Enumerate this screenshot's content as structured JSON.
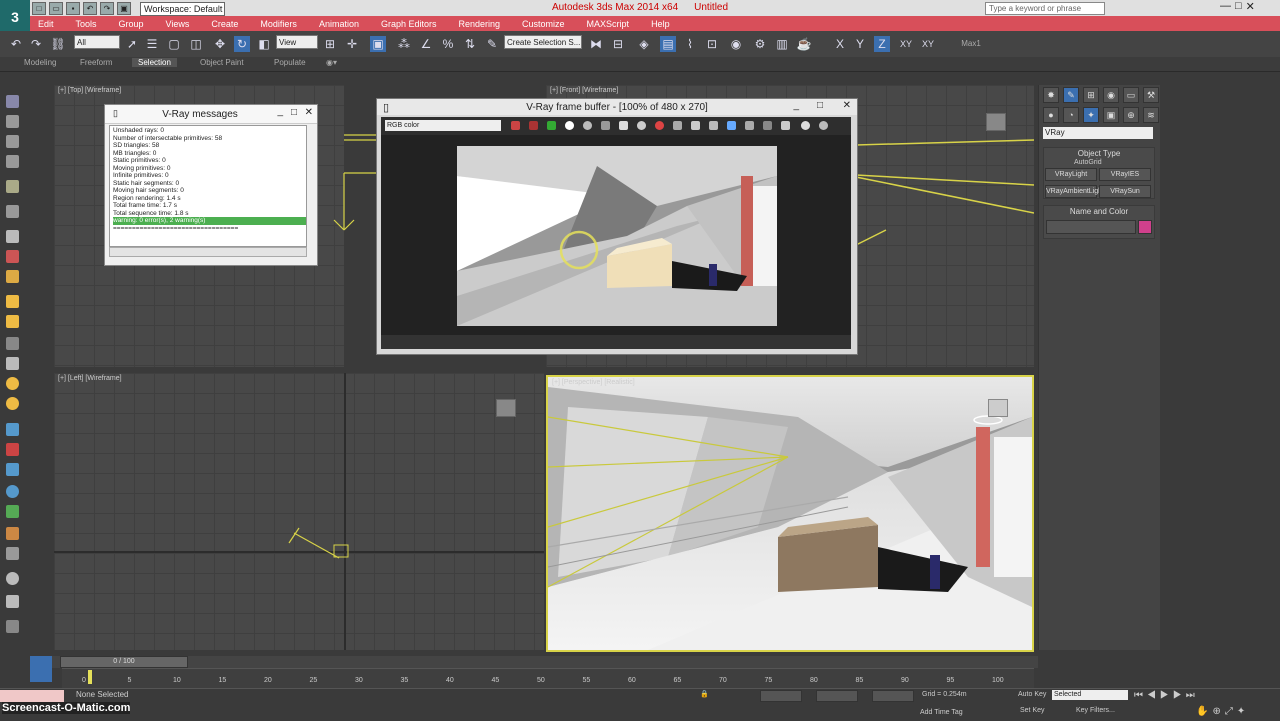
{
  "app": {
    "title": "Autodesk 3ds Max  2014 x64",
    "document": "Untitled",
    "workspace": "Workspace: Default",
    "help_placeholder": "Type a keyword or phrase"
  },
  "menus": [
    "Edit",
    "Tools",
    "Group",
    "Views",
    "Create",
    "Modifiers",
    "Animation",
    "Graph Editors",
    "Rendering",
    "Customize",
    "MAXScript",
    "Help"
  ],
  "toolbar": {
    "filter": "All",
    "view": "View",
    "selection_set": "Create Selection S...",
    "axes": [
      "X",
      "Y",
      "Z",
      "XY",
      "XY"
    ],
    "icons": [
      "undo-icon",
      "redo-icon",
      "link-icon",
      "unlink-icon",
      "bind-icon",
      "select-icon",
      "select-name-icon",
      "region-icon",
      "window-icon",
      "move-icon",
      "rotate-icon",
      "scale-icon",
      "pivot-icon",
      "snap-icon",
      "angle-snap-icon",
      "percent-snap-icon",
      "spinner-snap-icon",
      "mirror-icon",
      "align-icon",
      "layer-icon",
      "curve-editor-icon",
      "schematic-icon",
      "material-editor-icon",
      "render-setup-icon",
      "rendered-frame-icon",
      "render-icon"
    ]
  },
  "ribbon_tabs": [
    "Modeling",
    "Freeform",
    "Selection",
    "Object Paint",
    "Populate"
  ],
  "ribbon_active": "Selection",
  "viewports": {
    "top": "[+] [Top] [Wireframe]",
    "front": "[+] [Front] [Wireframe]",
    "left": "[+] [Left] [Wireframe]",
    "perspective": "[+] [Perspective] [Realistic]"
  },
  "vray_messages": {
    "title": "V-Ray messages",
    "lines": [
      "Unshaded rays: 0",
      "Number of intersectable primitives: 58",
      "SD triangles: 58",
      "MB triangles: 0",
      "Static primitives: 0",
      "Moving primitives: 0",
      "Infinite primitives: 0",
      "Static hair segments: 0",
      "Moving hair segments: 0",
      "Region rendering: 1.4 s",
      "Total frame time: 1.7 s",
      "Total sequence time: 1.8 s",
      "warning: 0 error(s), 2 warning(s)",
      "================================="
    ],
    "highlighted_index": 12
  },
  "vray_frame_buffer": {
    "title": "V-Ray frame buffer - [100% of 480 x 270]",
    "channel": "RGB color"
  },
  "command_panel": {
    "renderer": "VRay",
    "object_type_header": "Object Type",
    "autogrid": "AutoGrid",
    "buttons": [
      "VRayLight",
      "VRayIES",
      "VRayAmbientLight",
      "VRaySun"
    ],
    "name_color_header": "Name and Color",
    "color_swatch": "#d0408c"
  },
  "timeline": {
    "frame": "0 / 100",
    "ticks": [
      "0",
      "5",
      "10",
      "15",
      "20",
      "25",
      "30",
      "35",
      "40",
      "45",
      "50",
      "55",
      "60",
      "65",
      "70",
      "75",
      "80",
      "85",
      "90",
      "95",
      "100"
    ]
  },
  "status": {
    "selection": "None Selected",
    "grid": "Grid = 0.254m",
    "auto_key": "Auto Key",
    "set_key": "Set Key",
    "selected": "Selected",
    "key_filters": "Key Filters...",
    "add_time_tag": "Add Time Tag"
  },
  "watermark": "Screencast-O-Matic.com",
  "colors": {
    "menu_bar": "#d84f5a",
    "wireframe": "#e5e05a",
    "active_viewport": "#e5e05a",
    "pink_swatch": "#d0408c"
  }
}
